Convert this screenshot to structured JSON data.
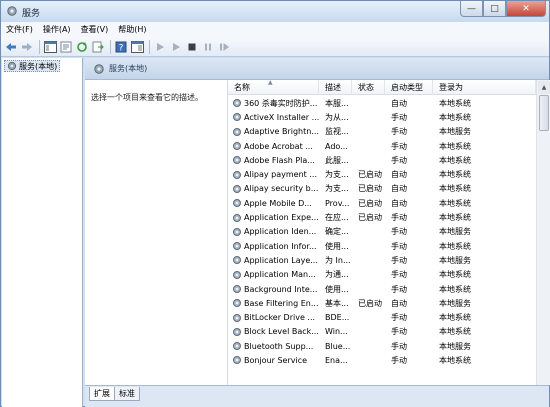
{
  "window": {
    "title": "服务"
  },
  "menu": [
    "文件(F)",
    "操作(A)",
    "查看(V)",
    "帮助(H)"
  ],
  "tree": {
    "root": "服务(本地)"
  },
  "pane": {
    "header": "服务(本地)",
    "description_prompt": "选择一个项目来查看它的描述。"
  },
  "columns": [
    "名称",
    "描述",
    "状态",
    "启动类型",
    "登录为"
  ],
  "services": [
    {
      "name": "360 杀毒实时防护...",
      "desc": "本服...",
      "status": "",
      "startup": "自动",
      "logon": "本地系统"
    },
    {
      "name": "ActiveX Installer ...",
      "desc": "为从...",
      "status": "",
      "startup": "手动",
      "logon": "本地系统"
    },
    {
      "name": "Adaptive Brightn...",
      "desc": "监视...",
      "status": "",
      "startup": "手动",
      "logon": "本地服务"
    },
    {
      "name": "Adobe Acrobat ...",
      "desc": "Ado...",
      "status": "",
      "startup": "手动",
      "logon": "本地系统"
    },
    {
      "name": "Adobe Flash Pla...",
      "desc": "此服...",
      "status": "",
      "startup": "手动",
      "logon": "本地系统"
    },
    {
      "name": "Alipay payment ...",
      "desc": "为支...",
      "status": "已启动",
      "startup": "自动",
      "logon": "本地系统"
    },
    {
      "name": "Alipay security b...",
      "desc": "为支...",
      "status": "已启动",
      "startup": "自动",
      "logon": "本地系统"
    },
    {
      "name": "Apple Mobile D...",
      "desc": "Prov...",
      "status": "已启动",
      "startup": "自动",
      "logon": "本地系统"
    },
    {
      "name": "Application Expe...",
      "desc": "在应...",
      "status": "已启动",
      "startup": "手动",
      "logon": "本地系统"
    },
    {
      "name": "Application Iden...",
      "desc": "确定...",
      "status": "",
      "startup": "手动",
      "logon": "本地服务"
    },
    {
      "name": "Application Infor...",
      "desc": "使用...",
      "status": "",
      "startup": "手动",
      "logon": "本地系统"
    },
    {
      "name": "Application Laye...",
      "desc": "为 In...",
      "status": "",
      "startup": "手动",
      "logon": "本地服务"
    },
    {
      "name": "Application Man...",
      "desc": "为通...",
      "status": "",
      "startup": "手动",
      "logon": "本地系统"
    },
    {
      "name": "Background Inte...",
      "desc": "使用...",
      "status": "",
      "startup": "手动",
      "logon": "本地系统"
    },
    {
      "name": "Base Filtering En...",
      "desc": "基本...",
      "status": "已启动",
      "startup": "自动",
      "logon": "本地服务"
    },
    {
      "name": "BitLocker Drive ...",
      "desc": "BDE...",
      "status": "",
      "startup": "手动",
      "logon": "本地系统"
    },
    {
      "name": "Block Level Back...",
      "desc": "Win...",
      "status": "",
      "startup": "手动",
      "logon": "本地系统"
    },
    {
      "name": "Bluetooth Supp...",
      "desc": "Blue...",
      "status": "",
      "startup": "手动",
      "logon": "本地服务"
    },
    {
      "name": "Bonjour Service",
      "desc": "Ena...",
      "status": "",
      "startup": "手动",
      "logon": "本地系统"
    }
  ],
  "tabs": [
    "扩展",
    "标准"
  ]
}
